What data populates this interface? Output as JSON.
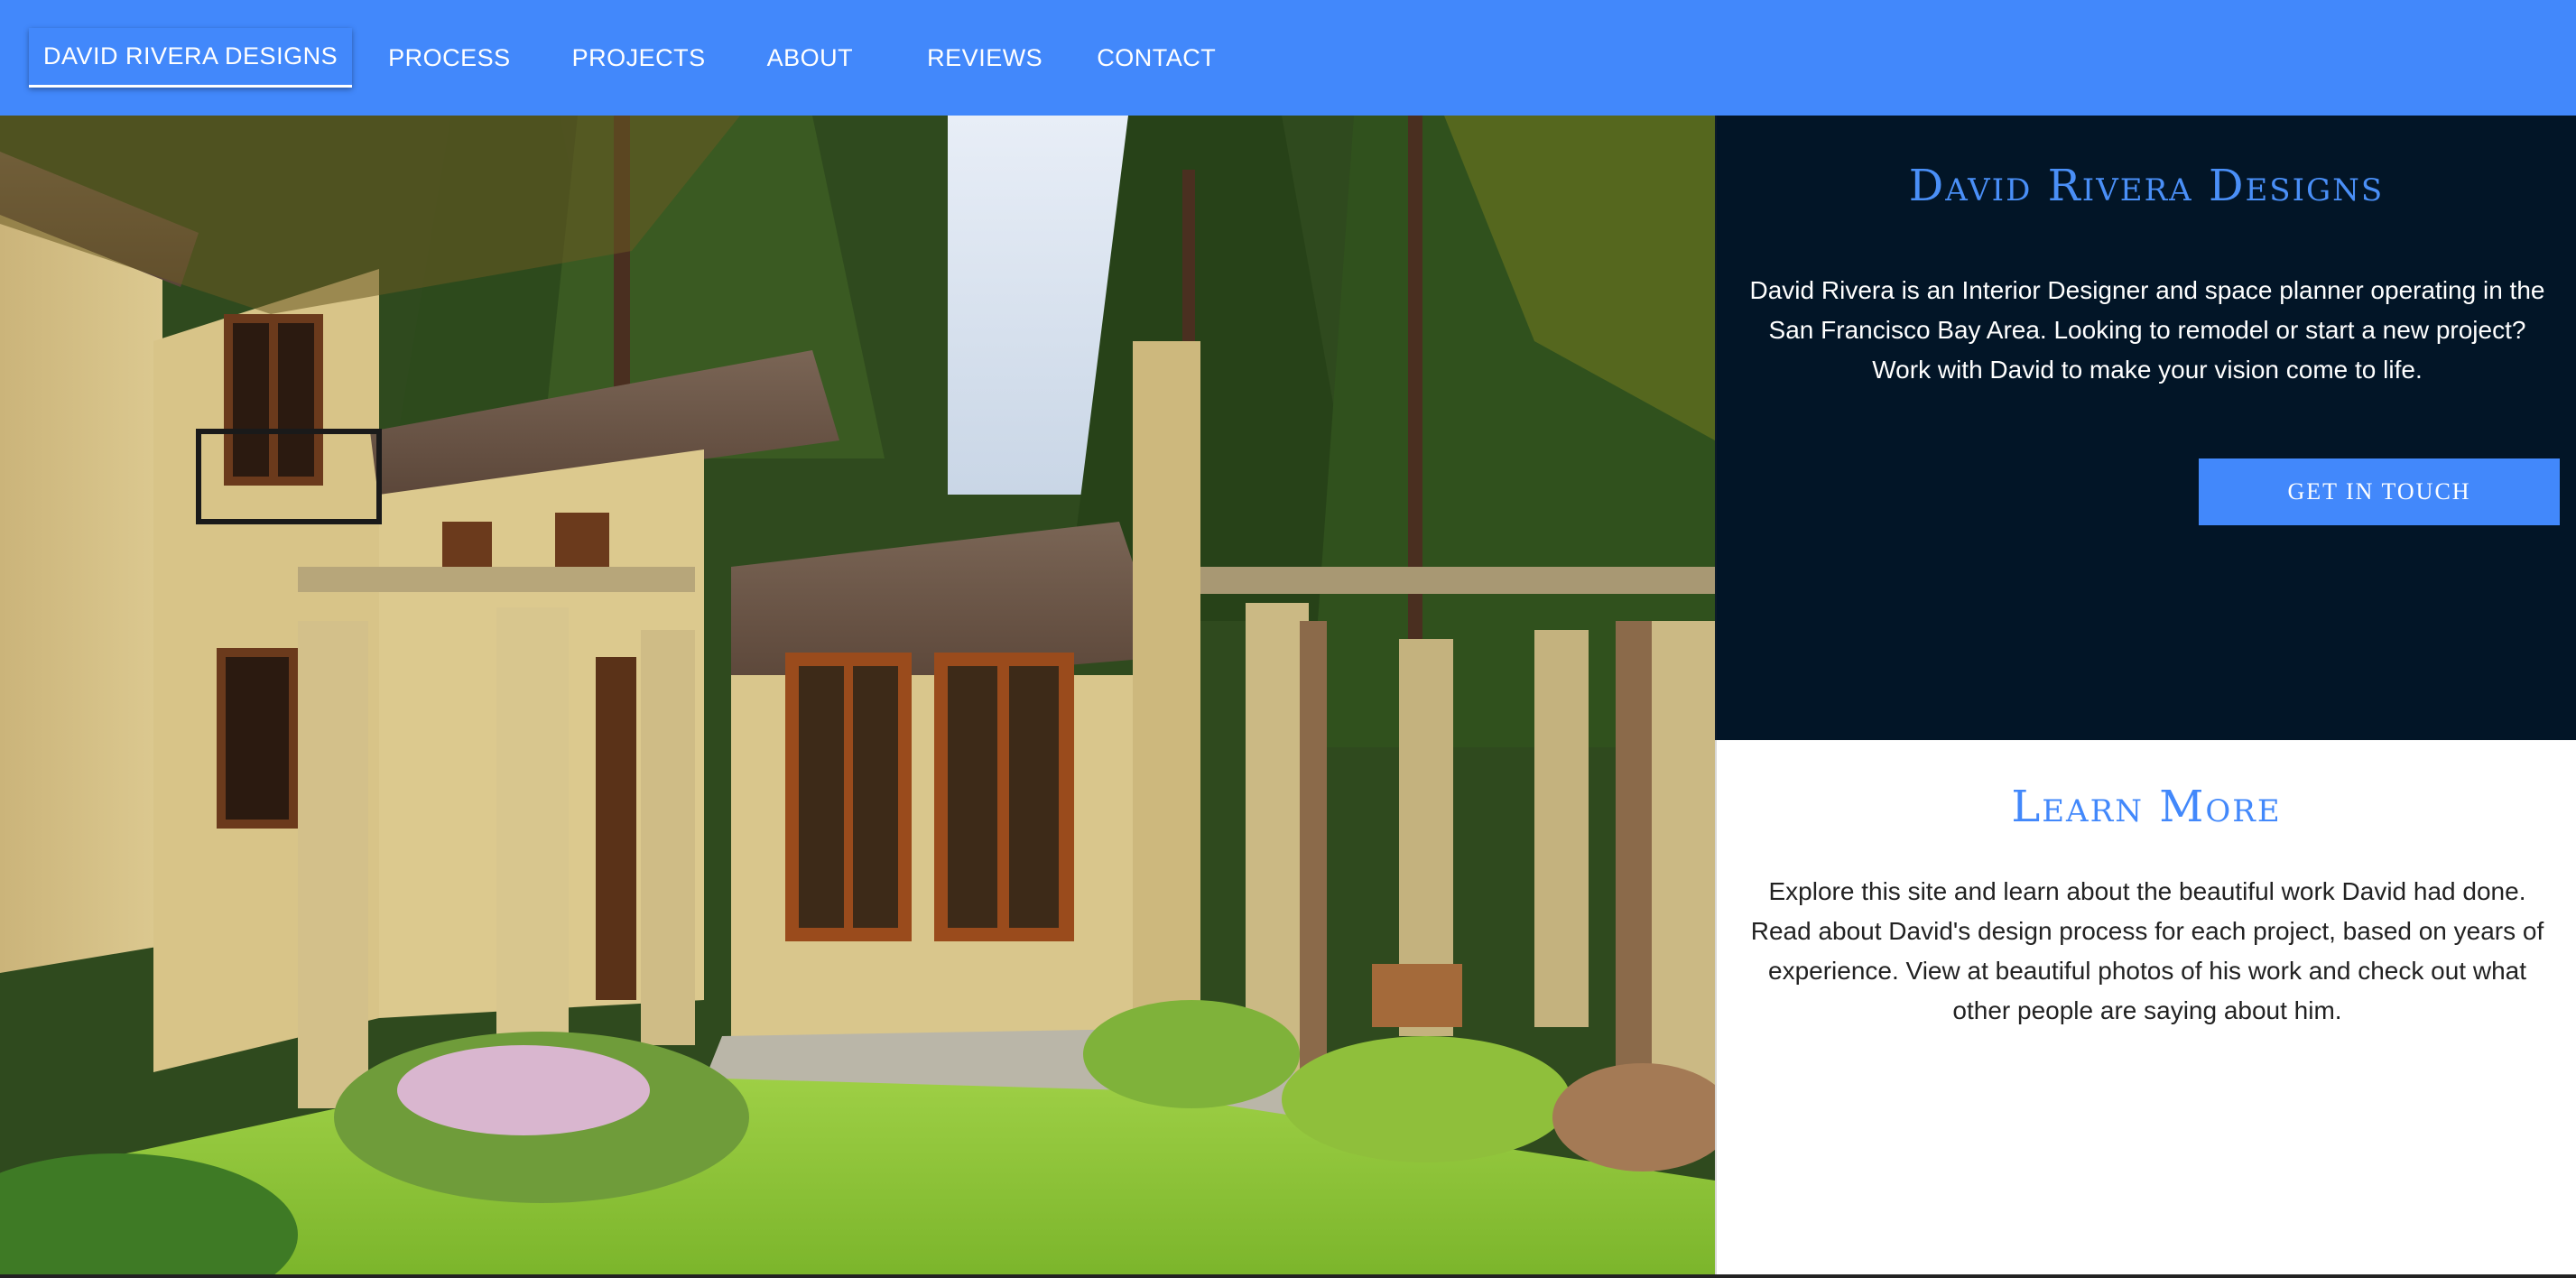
{
  "nav": {
    "brand": "DAVID RIVERA DESIGNS",
    "items": [
      {
        "label": "PROCESS"
      },
      {
        "label": "PROJECTS"
      },
      {
        "label": "ABOUT"
      },
      {
        "label": "REVIEWS"
      },
      {
        "label": "CONTACT"
      }
    ]
  },
  "intro": {
    "title": "David Rivera Designs",
    "text": "David Rivera is an Interior Designer and space planner operating in the San Francisco Bay Area. Looking to remodel or start a new project? Work with David to make your vision come to life.",
    "button_label": "GET IN TOUCH"
  },
  "learn_more": {
    "title": "Learn More",
    "text": "Explore this site and learn about the beautiful work David had done. Read about David's design process for each project, based on years of experience. View at beautiful photos of his work and check out what other people are saying about him."
  },
  "colors": {
    "nav_bg": "#4288fb",
    "dark_panel_bg": "#021527",
    "accent": "#4288fb"
  }
}
